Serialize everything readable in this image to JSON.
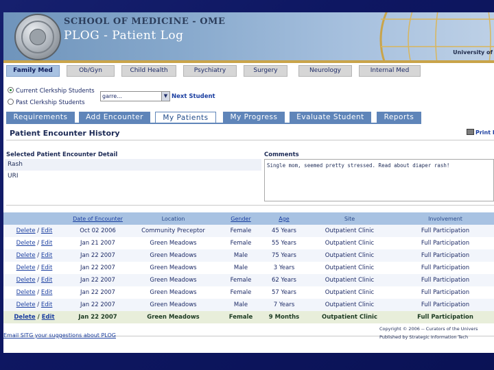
{
  "header": {
    "school": "SCHOOL OF MEDICINE - OME",
    "app_title": "PLOG - Patient Log",
    "university": "University of"
  },
  "rotation_tabs": [
    {
      "label": "Family Med",
      "active": true
    },
    {
      "label": "Ob/Gyn",
      "active": false
    },
    {
      "label": "Child Health",
      "active": false
    },
    {
      "label": "Psychiatry",
      "active": false
    },
    {
      "label": "Surgery",
      "active": false
    },
    {
      "label": "Neurology",
      "active": false
    },
    {
      "label": "Internal Med",
      "active": false
    }
  ],
  "student_filter": {
    "current_label": "Current Clerkship Students",
    "past_label": "Past Clerkship Students",
    "selected": "current",
    "dropdown_value": "garre...",
    "next_label": "Next Student"
  },
  "function_tabs": [
    {
      "label": "Requirements",
      "active": false
    },
    {
      "label": "Add Encounter",
      "active": false
    },
    {
      "label": "My Patients",
      "active": true
    },
    {
      "label": "My Progress",
      "active": false
    },
    {
      "label": "Evaluate Student",
      "active": false
    },
    {
      "label": "Reports",
      "active": false
    }
  ],
  "history": {
    "title": "Patient Encounter History",
    "print_label": "Print P"
  },
  "detail": {
    "label": "Selected Patient Encounter Detail",
    "items": [
      "Rash",
      "URI"
    ],
    "comments_label": "Comments",
    "comments": "Single mom, seemed pretty stressed. Read about diaper rash!"
  },
  "table": {
    "headers": [
      "",
      "Date of Encounter",
      "Location",
      "Gender",
      "Age",
      "Site",
      "Involvement"
    ],
    "delete_label": "Delete",
    "edit_label": "Edit",
    "rows": [
      {
        "date": "Oct 02 2006",
        "location": "Community Preceptor",
        "gender": "Female",
        "age": "45 Years",
        "site": "Outpatient Clinic",
        "involvement": "Full Participation"
      },
      {
        "date": "Jan 21 2007",
        "location": "Green Meadows",
        "gender": "Female",
        "age": "55 Years",
        "site": "Outpatient Clinic",
        "involvement": "Full Participation"
      },
      {
        "date": "Jan 22 2007",
        "location": "Green Meadows",
        "gender": "Male",
        "age": "75 Years",
        "site": "Outpatient Clinic",
        "involvement": "Full Participation"
      },
      {
        "date": "Jan 22 2007",
        "location": "Green Meadows",
        "gender": "Male",
        "age": "3 Years",
        "site": "Outpatient Clinic",
        "involvement": "Full Participation"
      },
      {
        "date": "Jan 22 2007",
        "location": "Green Meadows",
        "gender": "Female",
        "age": "62 Years",
        "site": "Outpatient Clinic",
        "involvement": "Full Participation"
      },
      {
        "date": "Jan 22 2007",
        "location": "Green Meadows",
        "gender": "Female",
        "age": "57 Years",
        "site": "Outpatient Clinic",
        "involvement": "Full Participation"
      },
      {
        "date": "Jan 22 2007",
        "location": "Green Meadows",
        "gender": "Male",
        "age": "7 Years",
        "site": "Outpatient Clinic",
        "involvement": "Full Participation"
      },
      {
        "date": "Jan 22 2007",
        "location": "Green Meadows",
        "gender": "Female",
        "age": "9 Months",
        "site": "Outpatient Clinic",
        "involvement": "Full Participation",
        "selected": true
      }
    ]
  },
  "footer": {
    "email_link": "Email SITG your suggestions about PLOG",
    "copyright_line1": "Copyright © 2006 -- Curators of the Univers",
    "copyright_line2": "Published by Strategic Information Tech"
  },
  "colors": {
    "banner": "#86a8cc",
    "active_rotation_tab": "#a8c2e2",
    "function_tab": "#5f85b9",
    "link": "#1a3ea0",
    "selected_row": "#e8eeda",
    "slide_background": "#0e1762"
  }
}
